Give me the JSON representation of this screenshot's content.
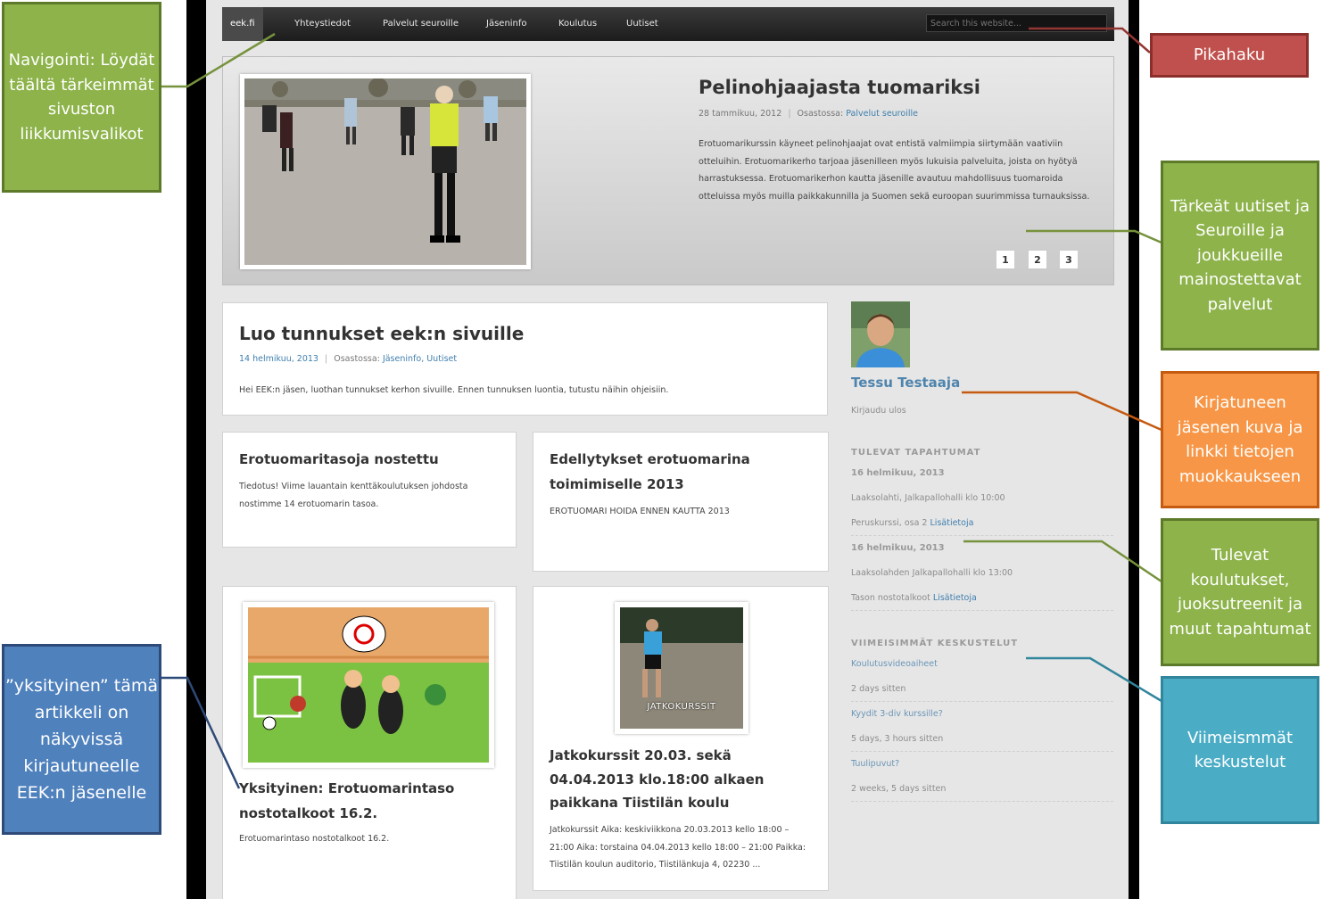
{
  "nav": {
    "items": [
      "eek.fi",
      "Yhteystiedot",
      "Palvelut seuroille",
      "Jäseninfo",
      "Koulutus",
      "Uutiset"
    ],
    "search_placeholder": "Search this website..."
  },
  "featured": {
    "title": "Pelinohjaajasta tuomariksi",
    "date": "28 tammikuu, 2012",
    "category_label": "Osastossa:",
    "category": "Palvelut seuroille",
    "text": "Erotuomarikurssin käyneet pelinohjaajat ovat entistä valmiimpia siirtymään vaativiin otteluihin. Erotuomarikerho tarjoaa jäsenilleen myös lukuisia palveluita, joista on hyötyä harrastuksessa. Erotuomarikerhon kautta jäsenille avautuu mahdollisuus tuomaroida otteluissa myös muilla paikkakunnilla ja Suomen sekä euroopan suurimmissa turnauksissa.",
    "pages": [
      "1",
      "2",
      "3"
    ]
  },
  "posts": [
    {
      "title": "Luo tunnukset eek:n sivuille",
      "date": "14 helmikuu, 2013",
      "category_label": "Osastossa:",
      "categories": "Jäseninfo, Uutiset",
      "text": "Hei EEK:n jäsen, luothan tunnukset kerhon sivuille. Ennen tunnuksen luontia, tutustu näihin ohjeisiin."
    },
    {
      "title": "Erotuomaritasoja nostettu",
      "text": "Tiedotus! Viime lauantain kenttäkoulutuksen johdosta nostimme 14 erotuomarin tasoa."
    },
    {
      "title": "Edellytykset erotuomarina toimimiselle 2013",
      "text": "EROTUOMARI HOIDA ENNEN KAUTTA 2013"
    },
    {
      "title": "Yksityinen: Erotuomarintaso nostotalkoot 16.2.",
      "text": "Erotuomarintaso nostotalkoot 16.2."
    },
    {
      "title": "Jatkokurssit 20.03. sekä 04.04.2013 klo.18:00 alkaen paikkana Tiistilän koulu",
      "image_caption": "JATKOKURSSIT",
      "text": "Jatkokurssit Aika: keskiviikkona 20.03.2013 kello 18:00 – 21:00 Aika: torstaina 04.04.2013 kello 18:00 – 21:00 Paikka: Tiistilän koulun auditorio, Tiistilänkuja 4, 02230 ..."
    }
  ],
  "sidebar": {
    "user_name": "Tessu Testaaja",
    "logout": "Kirjaudu ulos",
    "events_heading": "TULEVAT TAPAHTUMAT",
    "events": [
      {
        "date": "16 helmikuu, 2013",
        "place": "Laaksolahti, Jalkapallohalli klo 10:00",
        "desc": "Peruskurssi, osa 2",
        "more": "Lisätietoja"
      },
      {
        "date": "16 helmikuu, 2013",
        "place": "Laaksolahden Jalkapallohalli klo 13:00",
        "desc": "Tason nostotalkoot",
        "more": "Lisätietoja"
      }
    ],
    "discussions_heading": "VIIMEISIMMÄT KESKUSTELUT",
    "discussions": [
      {
        "title": "Koulutusvideoaiheet",
        "ago": "2 days sitten"
      },
      {
        "title": "Kyydit 3-div kurssille?",
        "ago": "5 days, 3 hours sitten"
      },
      {
        "title": "Tuulipuvut?",
        "ago": "2 weeks, 5 days sitten"
      }
    ]
  },
  "annotations": {
    "nav": "Navigointi: Löydät täältä tärkeimmät sivuston liikkumisvalikot",
    "search": "Pikahaku",
    "news": "Tärkeät uutiset ja Seuroille ja joukkueille mainostettavat palvelut",
    "member": "Kirjatuneen jäsenen kuva ja linkki tietojen muokkaukseen",
    "events": "Tulevat koulutukset, juoksutreenit ja muut tapahtumat",
    "discussions": "Viimeismmät keskustelut",
    "private": "”yksityinen” tämä artikkeli on näkyvissä kirjautuneelle EEK:n jäsenelle"
  },
  "colors": {
    "green": "#8db34a",
    "red": "#c0504d",
    "orange": "#f79646",
    "teal": "#4bacc6",
    "blue": "#4f81bd",
    "link": "#3f7fae"
  }
}
